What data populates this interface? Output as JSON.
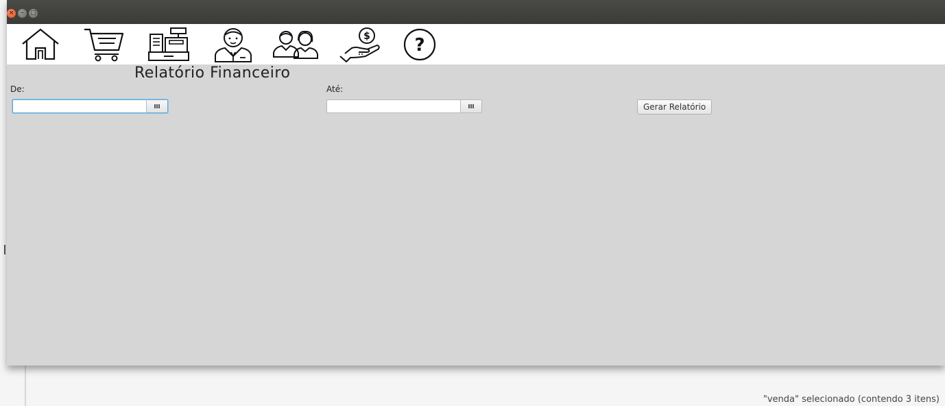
{
  "window": {
    "controls": {
      "close": "×",
      "minimize": "–",
      "maximize": "□"
    }
  },
  "toolbar": {
    "icons": [
      "home-icon",
      "shopping-cart-icon",
      "cash-register-icon",
      "employee-icon",
      "clients-icon",
      "payment-icon",
      "help-icon"
    ],
    "help_label": "?",
    "payment_label": "$"
  },
  "report": {
    "title": "Relatório Financeiro",
    "from_label": "De:",
    "to_label": "Até:",
    "from_value": "",
    "to_value": "",
    "generate_label": "Gerar Relatório"
  },
  "status_bar": {
    "text": "\"venda\" selecionado  (contendo 3 itens)"
  }
}
